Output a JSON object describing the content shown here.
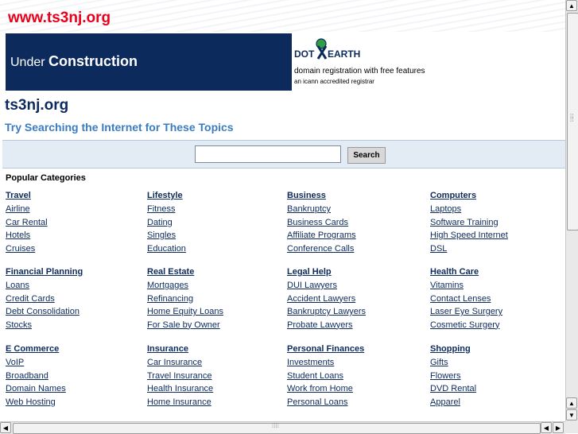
{
  "header": {
    "domain_title": "www.ts3nj.org"
  },
  "banner": {
    "prefix": "Under",
    "bold": "Construction"
  },
  "dotearth": {
    "logo_left": "DOT",
    "logo_right": "EARTH",
    "tagline": "domain registration with free features",
    "sub": "an icann accredited registrar"
  },
  "site_name": "ts3nj.org",
  "try_heading": "Try Searching the Internet for These Topics",
  "search": {
    "value": "",
    "button_label": "Search"
  },
  "popular_label": "Popular Categories",
  "categories": [
    {
      "title": "Travel",
      "links": [
        "Airline",
        "Car Rental",
        "Hotels",
        "Cruises"
      ]
    },
    {
      "title": "Lifestyle",
      "links": [
        "Fitness",
        "Dating",
        "Singles",
        "Education"
      ]
    },
    {
      "title": "Business",
      "links": [
        "Bankruptcy",
        "Business Cards",
        "Affiliate Programs",
        "Conference Calls"
      ]
    },
    {
      "title": "Computers",
      "links": [
        "Laptops",
        "Software Training",
        "High Speed Internet",
        "DSL"
      ]
    },
    {
      "title": "Financial Planning",
      "links": [
        "Loans",
        "Credit Cards",
        "Debt Consolidation",
        "Stocks"
      ]
    },
    {
      "title": "Real Estate",
      "links": [
        "Mortgages",
        "Refinancing",
        "Home Equity Loans",
        "For Sale by Owner"
      ]
    },
    {
      "title": "Legal Help",
      "links": [
        "DUI Lawyers",
        "Accident Lawyers",
        "Bankruptcy Lawyers",
        "Probate Lawyers"
      ]
    },
    {
      "title": "Health Care",
      "links": [
        "Vitamins",
        "Contact Lenses",
        "Laser Eye Surgery",
        "Cosmetic Surgery"
      ]
    },
    {
      "title": "E Commerce",
      "links": [
        "VoIP",
        "Broadband",
        "Domain Names",
        "Web Hosting"
      ]
    },
    {
      "title": "Insurance",
      "links": [
        "Car Insurance",
        "Travel Insurance",
        "Health Insurance",
        "Home Insurance"
      ]
    },
    {
      "title": "Personal Finances",
      "links": [
        "Investments",
        "Student Loans",
        "Work from Home",
        "Personal Loans"
      ]
    },
    {
      "title": "Shopping",
      "links": [
        "Gifts",
        "Flowers",
        "DVD Rental",
        "Apparel"
      ]
    }
  ],
  "colors": {
    "domain_red": "#e8001c",
    "navy": "#0c2a5b",
    "link_blue": "#3a7cc2",
    "search_band": "#e3ebf5"
  },
  "icons": {
    "up": "scroll-up-arrow-icon",
    "down": "scroll-down-arrow-icon",
    "left": "scroll-left-arrow-icon",
    "right": "scroll-right-arrow-icon"
  }
}
